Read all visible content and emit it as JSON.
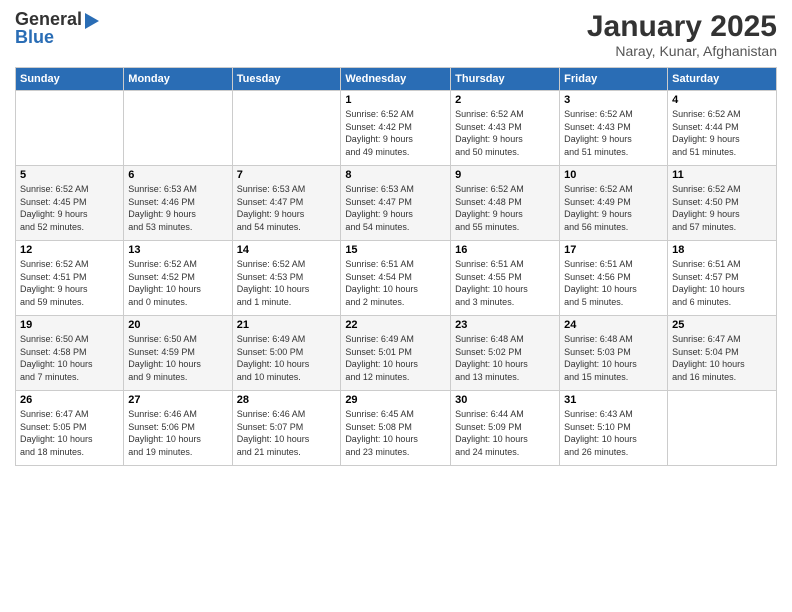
{
  "header": {
    "logo_line1": "General",
    "logo_line2": "Blue",
    "month": "January 2025",
    "location": "Naray, Kunar, Afghanistan"
  },
  "days_of_week": [
    "Sunday",
    "Monday",
    "Tuesday",
    "Wednesday",
    "Thursday",
    "Friday",
    "Saturday"
  ],
  "weeks": [
    [
      {
        "day": "",
        "info": ""
      },
      {
        "day": "",
        "info": ""
      },
      {
        "day": "",
        "info": ""
      },
      {
        "day": "1",
        "info": "Sunrise: 6:52 AM\nSunset: 4:42 PM\nDaylight: 9 hours\nand 49 minutes."
      },
      {
        "day": "2",
        "info": "Sunrise: 6:52 AM\nSunset: 4:43 PM\nDaylight: 9 hours\nand 50 minutes."
      },
      {
        "day": "3",
        "info": "Sunrise: 6:52 AM\nSunset: 4:43 PM\nDaylight: 9 hours\nand 51 minutes."
      },
      {
        "day": "4",
        "info": "Sunrise: 6:52 AM\nSunset: 4:44 PM\nDaylight: 9 hours\nand 51 minutes."
      }
    ],
    [
      {
        "day": "5",
        "info": "Sunrise: 6:52 AM\nSunset: 4:45 PM\nDaylight: 9 hours\nand 52 minutes."
      },
      {
        "day": "6",
        "info": "Sunrise: 6:53 AM\nSunset: 4:46 PM\nDaylight: 9 hours\nand 53 minutes."
      },
      {
        "day": "7",
        "info": "Sunrise: 6:53 AM\nSunset: 4:47 PM\nDaylight: 9 hours\nand 54 minutes."
      },
      {
        "day": "8",
        "info": "Sunrise: 6:53 AM\nSunset: 4:47 PM\nDaylight: 9 hours\nand 54 minutes."
      },
      {
        "day": "9",
        "info": "Sunrise: 6:52 AM\nSunset: 4:48 PM\nDaylight: 9 hours\nand 55 minutes."
      },
      {
        "day": "10",
        "info": "Sunrise: 6:52 AM\nSunset: 4:49 PM\nDaylight: 9 hours\nand 56 minutes."
      },
      {
        "day": "11",
        "info": "Sunrise: 6:52 AM\nSunset: 4:50 PM\nDaylight: 9 hours\nand 57 minutes."
      }
    ],
    [
      {
        "day": "12",
        "info": "Sunrise: 6:52 AM\nSunset: 4:51 PM\nDaylight: 9 hours\nand 59 minutes."
      },
      {
        "day": "13",
        "info": "Sunrise: 6:52 AM\nSunset: 4:52 PM\nDaylight: 10 hours\nand 0 minutes."
      },
      {
        "day": "14",
        "info": "Sunrise: 6:52 AM\nSunset: 4:53 PM\nDaylight: 10 hours\nand 1 minute."
      },
      {
        "day": "15",
        "info": "Sunrise: 6:51 AM\nSunset: 4:54 PM\nDaylight: 10 hours\nand 2 minutes."
      },
      {
        "day": "16",
        "info": "Sunrise: 6:51 AM\nSunset: 4:55 PM\nDaylight: 10 hours\nand 3 minutes."
      },
      {
        "day": "17",
        "info": "Sunrise: 6:51 AM\nSunset: 4:56 PM\nDaylight: 10 hours\nand 5 minutes."
      },
      {
        "day": "18",
        "info": "Sunrise: 6:51 AM\nSunset: 4:57 PM\nDaylight: 10 hours\nand 6 minutes."
      }
    ],
    [
      {
        "day": "19",
        "info": "Sunrise: 6:50 AM\nSunset: 4:58 PM\nDaylight: 10 hours\nand 7 minutes."
      },
      {
        "day": "20",
        "info": "Sunrise: 6:50 AM\nSunset: 4:59 PM\nDaylight: 10 hours\nand 9 minutes."
      },
      {
        "day": "21",
        "info": "Sunrise: 6:49 AM\nSunset: 5:00 PM\nDaylight: 10 hours\nand 10 minutes."
      },
      {
        "day": "22",
        "info": "Sunrise: 6:49 AM\nSunset: 5:01 PM\nDaylight: 10 hours\nand 12 minutes."
      },
      {
        "day": "23",
        "info": "Sunrise: 6:48 AM\nSunset: 5:02 PM\nDaylight: 10 hours\nand 13 minutes."
      },
      {
        "day": "24",
        "info": "Sunrise: 6:48 AM\nSunset: 5:03 PM\nDaylight: 10 hours\nand 15 minutes."
      },
      {
        "day": "25",
        "info": "Sunrise: 6:47 AM\nSunset: 5:04 PM\nDaylight: 10 hours\nand 16 minutes."
      }
    ],
    [
      {
        "day": "26",
        "info": "Sunrise: 6:47 AM\nSunset: 5:05 PM\nDaylight: 10 hours\nand 18 minutes."
      },
      {
        "day": "27",
        "info": "Sunrise: 6:46 AM\nSunset: 5:06 PM\nDaylight: 10 hours\nand 19 minutes."
      },
      {
        "day": "28",
        "info": "Sunrise: 6:46 AM\nSunset: 5:07 PM\nDaylight: 10 hours\nand 21 minutes."
      },
      {
        "day": "29",
        "info": "Sunrise: 6:45 AM\nSunset: 5:08 PM\nDaylight: 10 hours\nand 23 minutes."
      },
      {
        "day": "30",
        "info": "Sunrise: 6:44 AM\nSunset: 5:09 PM\nDaylight: 10 hours\nand 24 minutes."
      },
      {
        "day": "31",
        "info": "Sunrise: 6:43 AM\nSunset: 5:10 PM\nDaylight: 10 hours\nand 26 minutes."
      },
      {
        "day": "",
        "info": ""
      }
    ]
  ]
}
